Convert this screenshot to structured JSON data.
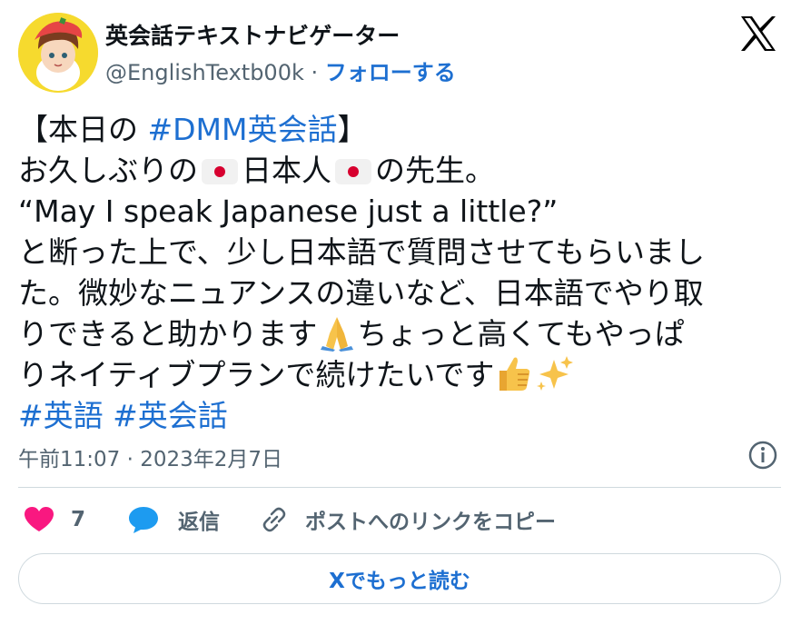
{
  "author": {
    "display_name": "英会話テキストナビゲーター",
    "handle": "@EnglishTextb00k",
    "separator": "·",
    "follow_label": "フォローする"
  },
  "tweet": {
    "lines": [
      {
        "pre": " 【本日の ",
        "hashtag": "#DMM英会話",
        "post": "】"
      },
      {
        "a": "お久しぶりの",
        "b": "日本人",
        "c": "の先生。"
      },
      {
        "text": "“May I speak Japanese just a little?”"
      },
      {
        "text": "と断った上で、少し日本語で質問させてもらいまし"
      },
      {
        "text": "た。微妙なニュアンスの違いなど、日本語でやり取"
      },
      {
        "pre": "りできると助かります",
        "post": "ちょっと高くてもやっぱ"
      },
      {
        "pre": "りネイティブプランで続けたいです"
      },
      {
        "hashtag1": "#英語",
        "space": " ",
        "hashtag2": "#英会話"
      }
    ]
  },
  "timestamp": "午前11:07 · 2023年2月7日",
  "actions": {
    "like_count": "7",
    "reply_label": "返信",
    "copy_link_label": "ポストへのリンクをコピー"
  },
  "read_more_label": "Xでもっと読む",
  "icons": {
    "logo": "x-logo-icon",
    "info": "info-icon",
    "like": "heart-icon",
    "reply": "speech-bubble-icon",
    "link": "link-icon",
    "flag": "japan-flag-icon",
    "pray": "folded-hands-icon",
    "thumbs": "thumbs-up-icon",
    "sparkles": "sparkles-icon"
  },
  "colors": {
    "link_blue": "#1d6fd1",
    "heart_pink": "#f91880",
    "reply_blue": "#1d9bf0",
    "secondary_text": "#536471"
  }
}
